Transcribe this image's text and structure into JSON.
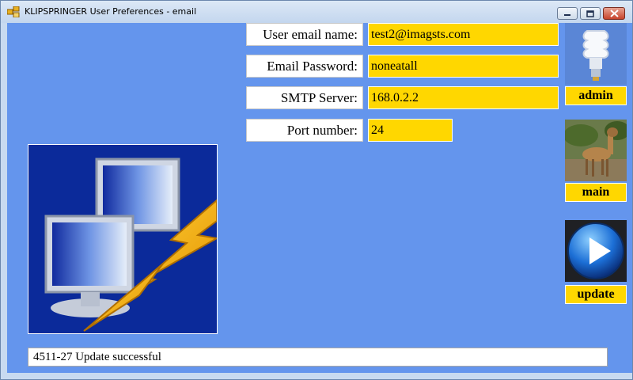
{
  "window": {
    "title": "KLIPSPRINGER User Preferences - email",
    "controls": {
      "minimize_icon": "minimize-icon",
      "maximize_icon": "maximize-icon",
      "close_icon": "close-icon"
    }
  },
  "form": {
    "email_name": {
      "label": "User email name:",
      "value": "test2@imagsts.com"
    },
    "email_password": {
      "label": "Email Password:",
      "value": "noneatall"
    },
    "smtp_server": {
      "label": "SMTP Server:",
      "value": "168.0.2.2"
    },
    "port_number": {
      "label": "Port number:",
      "value": "24"
    }
  },
  "sidebar": {
    "admin": {
      "label": "admin",
      "icon": "lightbulb-icon"
    },
    "main": {
      "label": "main",
      "icon": "deer-photo"
    },
    "update": {
      "label": "update",
      "icon": "play-icon"
    }
  },
  "illustration": {
    "icon": "network-computers-lightning-icon"
  },
  "status": {
    "text": "4511-27 Update successful"
  },
  "colors": {
    "background": "#6495ed",
    "field": "#ffd700",
    "label_bg": "#ffffff"
  }
}
